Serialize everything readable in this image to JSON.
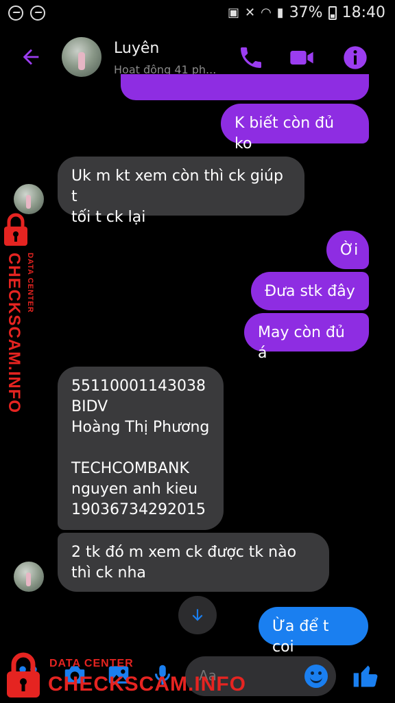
{
  "status_bar": {
    "battery": "37%",
    "time": "18:40"
  },
  "header": {
    "contact_name": "Luyên",
    "contact_status": "Hoạt động 41 ph..."
  },
  "messages": [
    {
      "direction": "outgoing",
      "text": ""
    },
    {
      "direction": "outgoing",
      "text": "K biết còn đủ ko"
    },
    {
      "direction": "incoming",
      "text": "Uk m kt xem còn thì ck giúp t\ntối t ck lại"
    },
    {
      "direction": "outgoing",
      "text": "Ời"
    },
    {
      "direction": "outgoing",
      "text": "Đưa stk đây"
    },
    {
      "direction": "outgoing",
      "text": "May còn đủ á"
    },
    {
      "direction": "incoming",
      "text": "55110001143038\nBIDV\nHoàng Thị Phương\n\nTECHCOMBANK\nnguyen anh kieu\n19036734292015"
    },
    {
      "direction": "incoming",
      "text": "2 tk đó m xem ck được tk nào\nthì ck nha"
    },
    {
      "direction": "outgoing",
      "text": "Ừa để t coi"
    }
  ],
  "composer": {
    "placeholder": "Aa"
  },
  "watermark": {
    "brand": "CHECKSCAM.INFO",
    "tagline": "DATA CENTER"
  },
  "colors": {
    "accent": "#8e2de2",
    "outgoing_blue": "#1a7ff0",
    "incoming": "#3a3a3c",
    "watermark_red": "#e52421"
  },
  "icons": {
    "back": "arrow-left-icon",
    "call": "phone-icon",
    "video": "video-camera-icon",
    "info": "info-icon",
    "scroll": "arrow-down-icon",
    "apps": "apps-icon",
    "camera": "camera-icon",
    "gallery": "image-icon",
    "mic": "microphone-icon",
    "emoji": "emoji-icon",
    "like": "thumbs-up-icon"
  }
}
